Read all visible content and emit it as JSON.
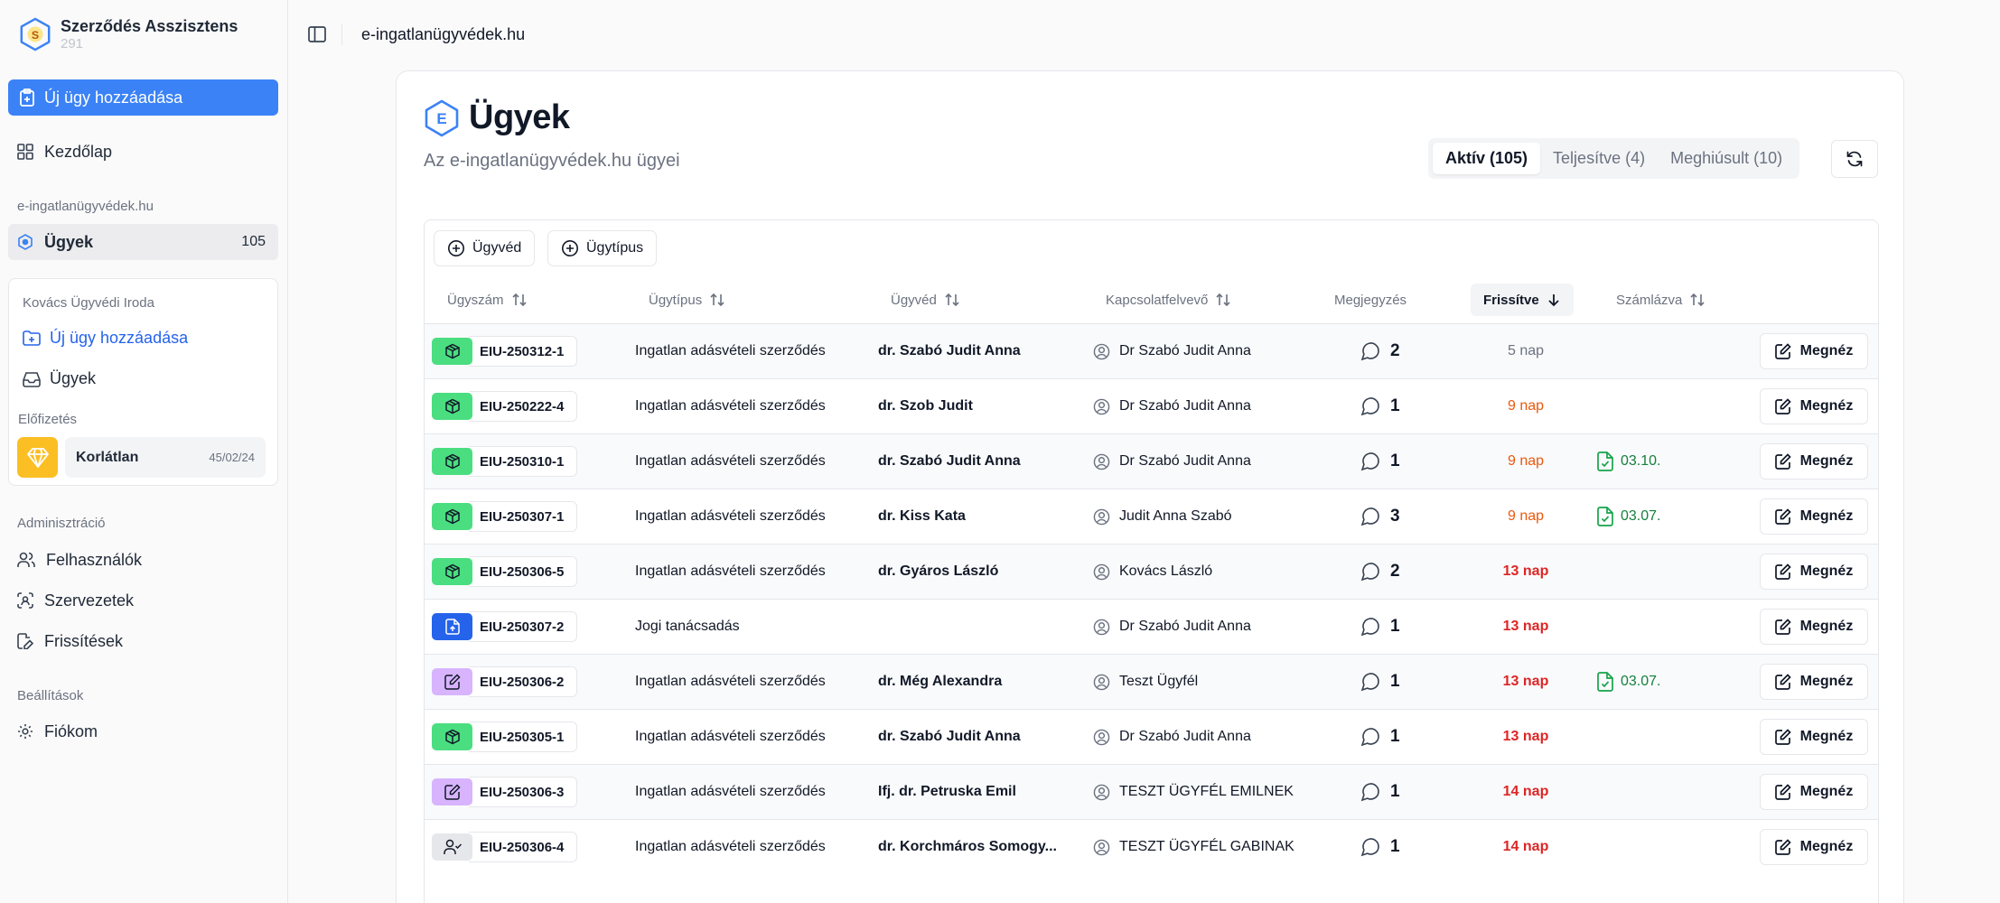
{
  "app": {
    "title": "Szerződés Asszisztens",
    "subtitle": "291",
    "logo_letter": "S"
  },
  "sidebar": {
    "primary_button": "Új ügy hozzáadása",
    "home": "Kezdőlap",
    "section_domain": "e-ingatlanügyvédek.hu",
    "cases": {
      "label": "Ügyek",
      "count": "105"
    },
    "org": {
      "title": "Kovács Ügyvédi Iroda",
      "new_case": "Új ügy hozzáadása",
      "cases": "Ügyek",
      "subscription_label": "Előfizetés",
      "plan_name": "Korlátlan",
      "plan_quota": "45/02/24"
    },
    "admin_label": "Adminisztráció",
    "admin_items": [
      "Felhasználók",
      "Szervezetek",
      "Frissítések"
    ],
    "settings_label": "Beállítások",
    "settings_items": [
      "Fiókom"
    ]
  },
  "header": {
    "breadcrumb": "e-ingatlanügyvédek.hu"
  },
  "page": {
    "logo_letter": "E",
    "title": "Ügyek",
    "subtitle": "Az e-ingatlanügyvédek.hu ügyei",
    "tabs": [
      "Aktív (105)",
      "Teljesítve (4)",
      "Meghiúsult (10)"
    ],
    "active_tab": 0
  },
  "filters": [
    "Ügyvéd",
    "Ügytípus"
  ],
  "columns": [
    "Ügyszám",
    "Ügytípus",
    "Ügyvéd",
    "Kapcsolatfelvevő",
    "Megjegyzés",
    "Frissítve",
    "Számlázva"
  ],
  "view_label": "Megnéz",
  "colors": {
    "accent": "#3b82f6",
    "green_icon": "#4ade80",
    "blue_icon": "#2563eb",
    "purple_icon": "#d8b4fe",
    "gray_icon": "#e5e7eb",
    "fresh_gray": "#6b7280",
    "fresh_orange": "#ea580c",
    "fresh_red": "#dc2626",
    "billed_green": "#15803d"
  },
  "rows": [
    {
      "id": "EIU-250312-1",
      "icon": "package-icon",
      "tone": "green",
      "type": "Ingatlan adásvételi szerződés",
      "lawyer": "dr. Szabó Judit Anna",
      "contact": "Dr Szabó Judit Anna",
      "notes": "2",
      "fresh": "5 nap",
      "fresh_level": "gray",
      "billed": ""
    },
    {
      "id": "EIU-250222-4",
      "icon": "package-icon",
      "tone": "green",
      "type": "Ingatlan adásvételi szerződés",
      "lawyer": "dr. Szob Judit",
      "contact": "Dr Szabó Judit Anna",
      "notes": "1",
      "fresh": "9 nap",
      "fresh_level": "orange",
      "billed": ""
    },
    {
      "id": "EIU-250310-1",
      "icon": "package-icon",
      "tone": "green",
      "type": "Ingatlan adásvételi szerződés",
      "lawyer": "dr. Szabó Judit Anna",
      "contact": "Dr Szabó Judit Anna",
      "notes": "1",
      "fresh": "9 nap",
      "fresh_level": "orange",
      "billed": "03.10."
    },
    {
      "id": "EIU-250307-1",
      "icon": "package-icon",
      "tone": "green",
      "type": "Ingatlan adásvételi szerződés",
      "lawyer": "dr. Kiss Kata",
      "contact": "Judit Anna Szabó",
      "notes": "3",
      "fresh": "9 nap",
      "fresh_level": "orange",
      "billed": "03.07."
    },
    {
      "id": "EIU-250306-5",
      "icon": "package-icon",
      "tone": "green",
      "type": "Ingatlan adásvételi szerződés",
      "lawyer": "dr. Gyáros László",
      "contact": "Kovács László",
      "notes": "2",
      "fresh": "13 nap",
      "fresh_level": "red",
      "billed": ""
    },
    {
      "id": "EIU-250307-2",
      "icon": "file-upload-icon",
      "tone": "blue",
      "type": "Jogi tanácsadás",
      "lawyer": "",
      "contact": "Dr Szabó Judit Anna",
      "notes": "1",
      "fresh": "13 nap",
      "fresh_level": "red",
      "billed": ""
    },
    {
      "id": "EIU-250306-2",
      "icon": "edit-doc-icon",
      "tone": "purple",
      "type": "Ingatlan adásvételi szerződés",
      "lawyer": "dr. Még Alexandra",
      "contact": "Teszt Ügyfél",
      "notes": "1",
      "fresh": "13 nap",
      "fresh_level": "red",
      "billed": "03.07."
    },
    {
      "id": "EIU-250305-1",
      "icon": "package-icon",
      "tone": "green",
      "type": "Ingatlan adásvételi szerződés",
      "lawyer": "dr. Szabó Judit Anna",
      "contact": "Dr Szabó Judit Anna",
      "notes": "1",
      "fresh": "13 nap",
      "fresh_level": "red",
      "billed": ""
    },
    {
      "id": "EIU-250306-3",
      "icon": "edit-doc-icon",
      "tone": "purple",
      "type": "Ingatlan adásvételi szerződés",
      "lawyer": "Ifj. dr. Petruska Emil",
      "contact": "TESZT ÜGYFÉL EMILNEK",
      "notes": "1",
      "fresh": "14 nap",
      "fresh_level": "red",
      "billed": ""
    },
    {
      "id": "EIU-250306-4",
      "icon": "user-check-icon",
      "tone": "gray",
      "type": "Ingatlan adásvételi szerződés",
      "lawyer": "dr. Korchmáros Somogy...",
      "contact": "TESZT ÜGYFÉL GABINAK",
      "notes": "1",
      "fresh": "14 nap",
      "fresh_level": "red",
      "billed": ""
    }
  ]
}
